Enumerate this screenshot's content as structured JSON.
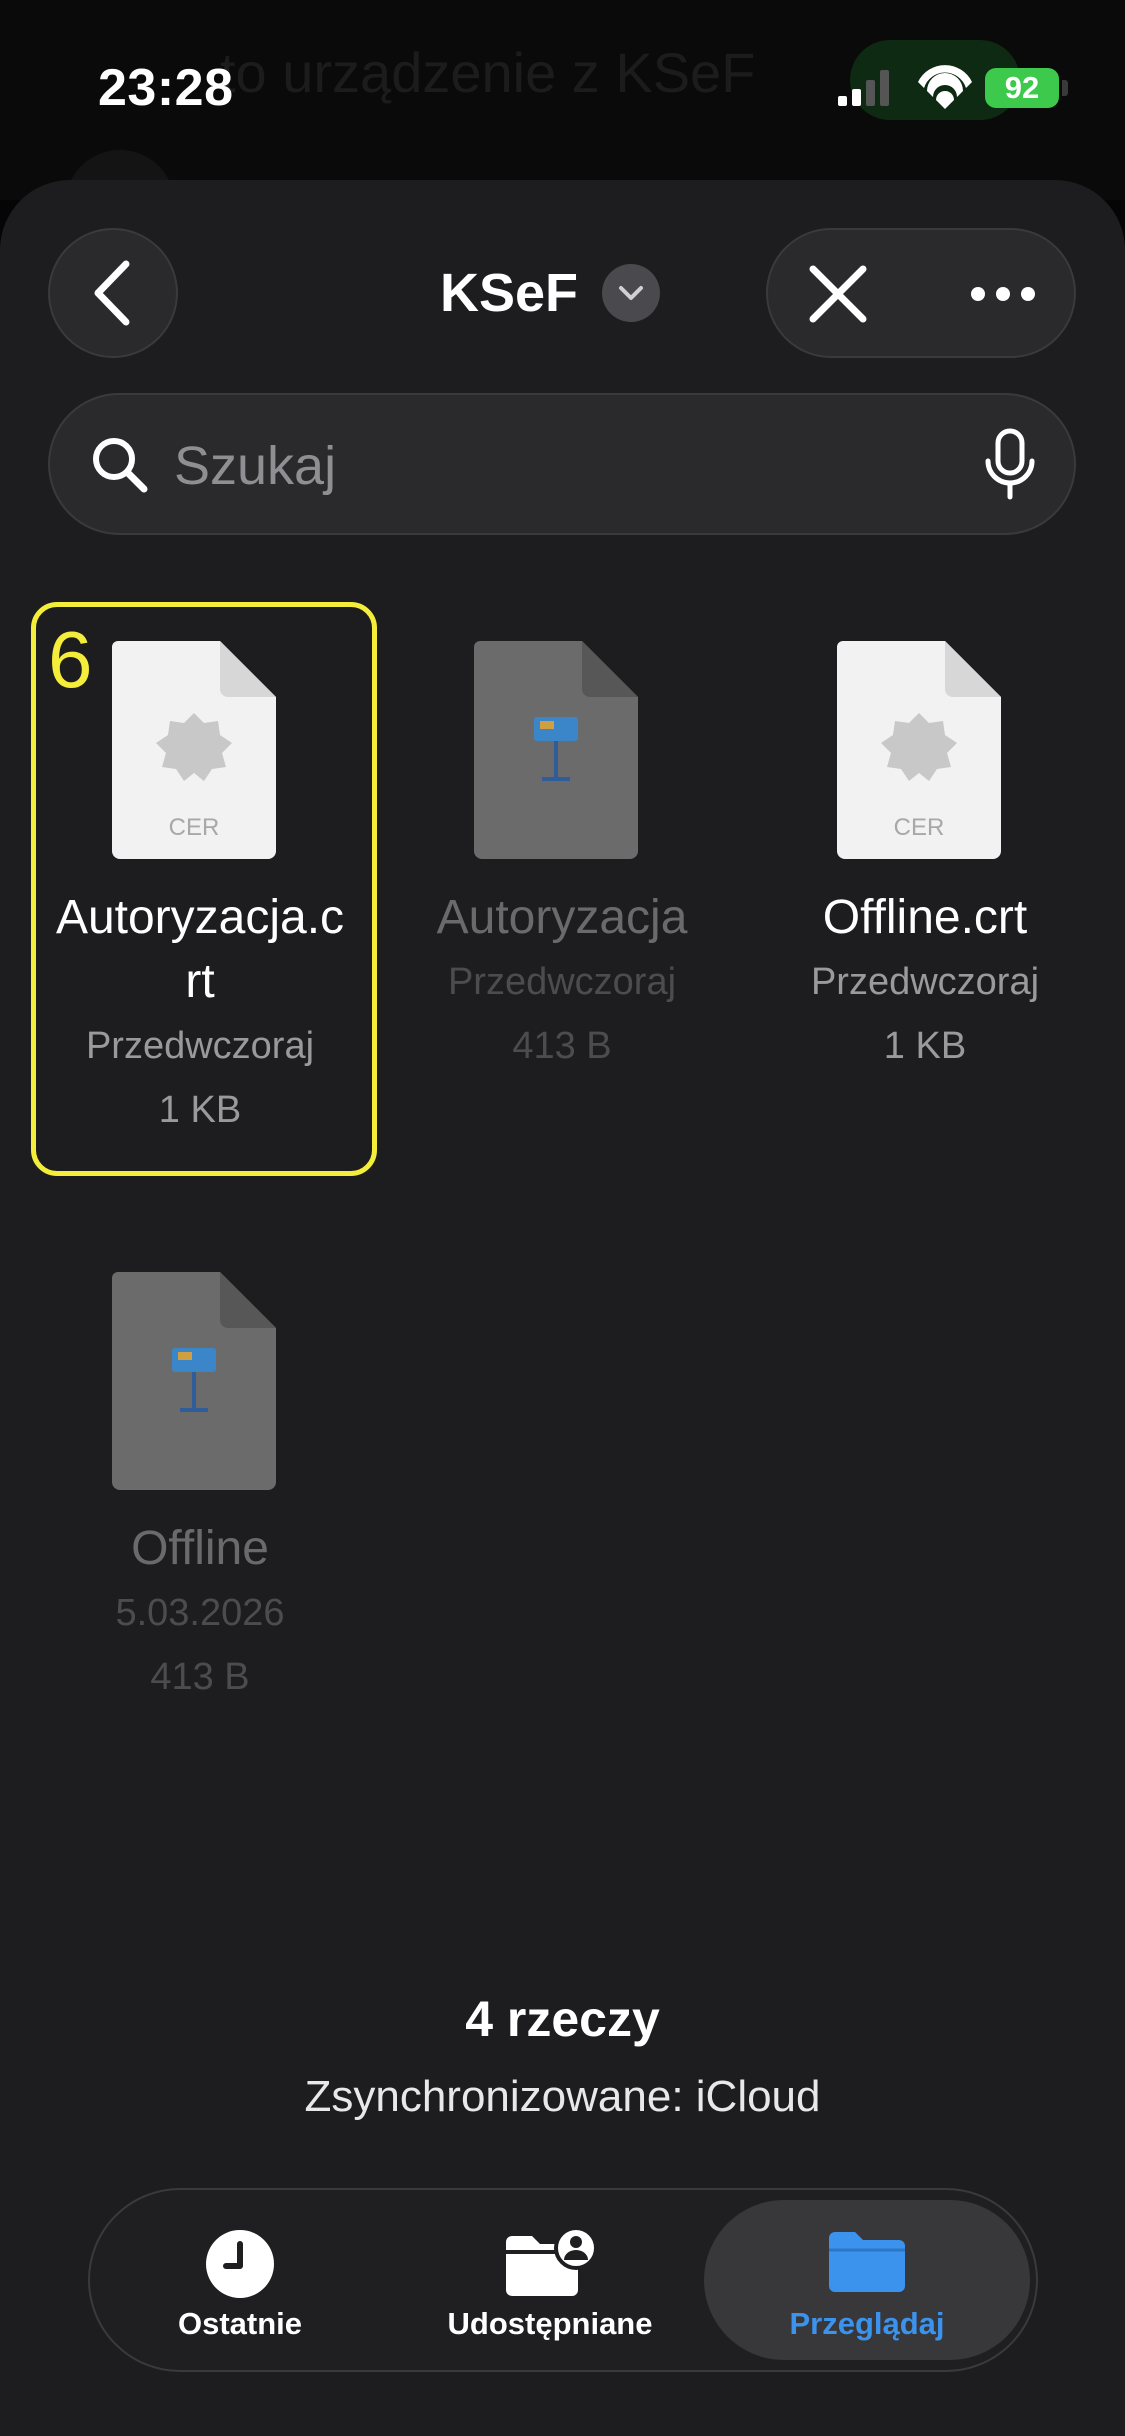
{
  "status_bar": {
    "time": "23:28",
    "battery": "92"
  },
  "background": {
    "title": "to urządzenie z KSeF"
  },
  "header": {
    "title": "KSeF"
  },
  "search": {
    "placeholder": "Szukaj"
  },
  "annotation": {
    "step": "6"
  },
  "files": [
    {
      "name": "Autoryzacja.c\nrt",
      "date": "Przedwczoraj",
      "size": "1 KB",
      "icon": "certificate-icon",
      "icon_label": "CER",
      "dimmed": false,
      "selected": true
    },
    {
      "name": "Autoryzacja",
      "date": "Przedwczoraj",
      "size": "413 B",
      "icon": "keynote-icon",
      "dimmed": true,
      "selected": false
    },
    {
      "name": "Offline.crt",
      "date": "Przedwczoraj",
      "size": "1 KB",
      "icon": "certificate-icon",
      "icon_label": "CER",
      "dimmed": false,
      "selected": false
    },
    {
      "name": "Offline",
      "date": "5.03.2026",
      "size": "413 B",
      "icon": "keynote-icon",
      "dimmed": true,
      "selected": false
    }
  ],
  "footer": {
    "count": "4 rzeczy",
    "sync": "Zsynchronizowane: iCloud"
  },
  "tabs": [
    {
      "label": "Ostatnie",
      "icon": "clock-icon",
      "active": false
    },
    {
      "label": "Udostępniane",
      "icon": "shared-folder-icon",
      "active": false
    },
    {
      "label": "Przeglądaj",
      "icon": "folder-icon",
      "active": true
    }
  ],
  "colors": {
    "accent": "#3b93ee",
    "selection": "#f4ee3a",
    "battery": "#3cc94c"
  }
}
